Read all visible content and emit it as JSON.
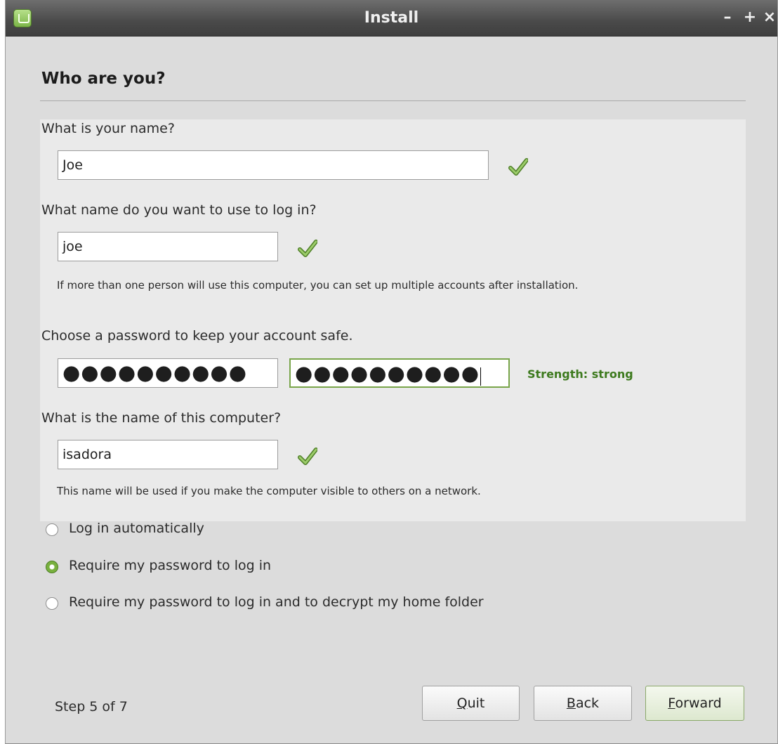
{
  "window": {
    "title": "Install",
    "controls": {
      "minimize": "–",
      "maximize": "+",
      "close": "×"
    }
  },
  "heading": "Who are you?",
  "name_section": {
    "label": "What is your name?",
    "value": "Joe",
    "valid": true
  },
  "login_section": {
    "label": "What name do you want to use to log in?",
    "value": "joe",
    "valid": true,
    "hint": "If more than one person will use this computer, you can set up multiple accounts after installation."
  },
  "password_section": {
    "label": "Choose a password to keep your account safe.",
    "password_mask": "●●●●●●●●●●",
    "confirm_mask": "●●●●●●●●●●",
    "strength": "Strength: strong"
  },
  "computer_section": {
    "label": "What is the name of this computer?",
    "value": "isadora",
    "valid": true,
    "hint": "This name will be used if you make the computer visible to others on a network."
  },
  "login_options": [
    {
      "label": "Log in automatically",
      "selected": false
    },
    {
      "label": "Require my password to log in",
      "selected": true
    },
    {
      "label": "Require my password to log in and to decrypt my home folder",
      "selected": false
    }
  ],
  "footer": {
    "step": "Step 5 of 7",
    "quit": {
      "mnemonic": "Q",
      "rest": "uit"
    },
    "back": {
      "mnemonic": "B",
      "rest": "ack"
    },
    "forward": {
      "mnemonic": "F",
      "rest": "orward"
    }
  },
  "colors": {
    "accent_green": "#78b03e",
    "strength_text": "#3d7a1e",
    "titlebar": "#4a4a4a",
    "window_bg": "#dcdcdc"
  }
}
